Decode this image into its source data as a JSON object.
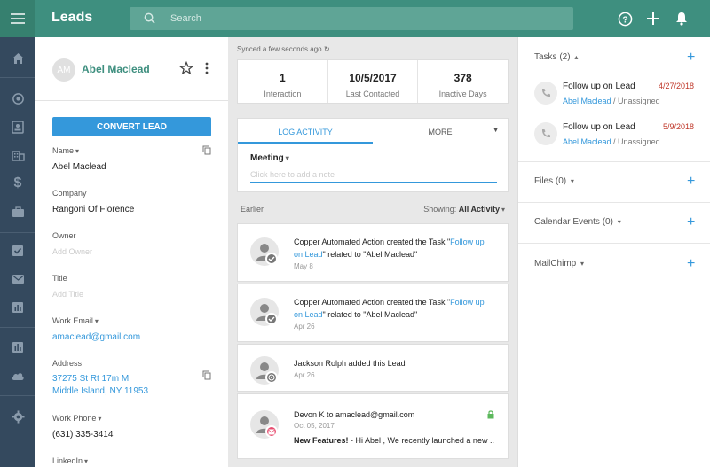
{
  "header": {
    "title": "Leads",
    "search_placeholder": "Search",
    "icons": [
      "help-icon",
      "plus-icon",
      "bell-icon"
    ]
  },
  "rail": {
    "icons": [
      "menu-icon",
      "home-icon",
      "target-icon",
      "contacts-icon",
      "building-icon",
      "dollar-icon",
      "briefcase-icon",
      "check-icon",
      "mail-icon",
      "chart-icon",
      "bar-report-icon",
      "cloud-icon",
      "gear-icon"
    ]
  },
  "lead": {
    "initials": "AM",
    "name": "Abel Maclead",
    "convert_label": "Convert Lead",
    "fields": {
      "name_label": "Name",
      "name_value": "Abel Maclead",
      "company_label": "Company",
      "company_value": "Rangoni Of Florence",
      "owner_label": "Owner",
      "owner_placeholder": "Add Owner",
      "title_label": "Title",
      "title_placeholder": "Add Title",
      "email_label": "Work Email",
      "email_value": "amaclead@gmail.com",
      "address_label": "Address",
      "address_line1": "37275 St Rt 17m M",
      "address_line2": "Middle Island, NY 11953",
      "phone_label": "Work Phone",
      "phone_value": "(631) 335-3414",
      "linkedin_label": "LinkedIn"
    }
  },
  "activity": {
    "synced": "Synced a few seconds ago",
    "stats": [
      {
        "value": "1",
        "label": "Interaction"
      },
      {
        "value": "10/5/2017",
        "label": "Last Contacted"
      },
      {
        "value": "378",
        "label": "Inactive Days"
      }
    ],
    "tabs": {
      "log": "Log Activity",
      "more": "More"
    },
    "activity_type": "Meeting",
    "note_placeholder": "Click here to add a note",
    "earlier_label": "Earlier",
    "showing_label": "Showing:",
    "showing_value": "All Activity",
    "feed": [
      {
        "pre": "Copper Automated Action created the Task \"",
        "link": "Follow up on Lead",
        "post": "\" related to \"Abel Maclead\"",
        "date": "May 8",
        "badge": "check-icon"
      },
      {
        "pre": "Copper Automated Action created the Task \"",
        "link": "Follow up on Lead",
        "post": "\" related to \"Abel Maclead\"",
        "date": "Apr 26",
        "badge": "check-icon"
      },
      {
        "text": "Jackson Rolph added this Lead",
        "date": "Apr 26",
        "badge": "target-icon"
      },
      {
        "text": "Devon K to amaclead@gmail.com",
        "date": "Oct 05, 2017",
        "subject": "New Features!",
        "snippet": " - Hi Abel , We recently launched a new ...",
        "badge": "mail-icon"
      }
    ]
  },
  "sidebar": {
    "tasks_title": "Tasks (2)",
    "tasks": [
      {
        "title": "Follow up on Lead",
        "related": "Abel Maclead",
        "assignee": " / Unassigned",
        "date": "4/27/2018"
      },
      {
        "title": "Follow up on Lead",
        "related": "Abel Maclead",
        "assignee": " / Unassigned",
        "date": "5/9/2018"
      }
    ],
    "files_title": "Files (0)",
    "calendar_title": "Calendar Events (0)",
    "mailchimp_title": "MailChimp"
  },
  "colors": {
    "brand": "#3e8f7f",
    "accent": "#3498db",
    "rail": "#34495e",
    "due": "#c0392b"
  }
}
